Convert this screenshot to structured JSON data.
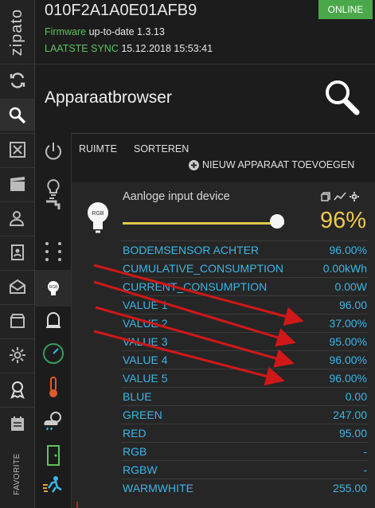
{
  "app": {
    "logo": "zipato",
    "favorite_label": "FAVORITE"
  },
  "header": {
    "device_id": "010F2A1A0E01AFB9",
    "status": "ONLINE",
    "firmware_label": "Firmware",
    "firmware_value": "up-to-date 1.3.13",
    "sync_label": "LAATSTE SYNC",
    "sync_value": "15.12.2018 15:53:41"
  },
  "page": {
    "title": "Apparaatbrowser"
  },
  "toolbar": {
    "room": "RUIMTE",
    "sort": "SORTEREN",
    "add_device": "NIEUW APPARAAT TOEVOEGEN"
  },
  "device": {
    "icon_text": "RGB",
    "name": "Aanloge input device",
    "level_percent": 96,
    "level_text": "96%",
    "attributes": [
      {
        "name": "BODEMSENSOR ACHTER",
        "value": "96.00%"
      },
      {
        "name": "CUMULATIVE_CONSUMPTION",
        "value": "0.00kWh"
      },
      {
        "name": "CURRENT_CONSUMPTION",
        "value": "0.00W"
      },
      {
        "name": "VALUE 1",
        "value": "96.00"
      },
      {
        "name": "VALUE 2",
        "value": "37.00%"
      },
      {
        "name": "VALUE 3",
        "value": "95.00%"
      },
      {
        "name": "VALUE 4",
        "value": "96.00%"
      },
      {
        "name": "VALUE 5",
        "value": "96.00%"
      },
      {
        "name": "BLUE",
        "value": "0.00"
      },
      {
        "name": "GREEN",
        "value": "247.00"
      },
      {
        "name": "RED",
        "value": "95.00"
      },
      {
        "name": "RGB",
        "value": "-"
      },
      {
        "name": "RGBW",
        "value": "-"
      },
      {
        "name": "WARMWHITE",
        "value": "255.00"
      }
    ]
  },
  "colors": {
    "accent_blue": "#3cb5e6",
    "online_green": "#4aa84a",
    "level_yellow": "#f0c84a",
    "annotation_red": "#d01818"
  }
}
